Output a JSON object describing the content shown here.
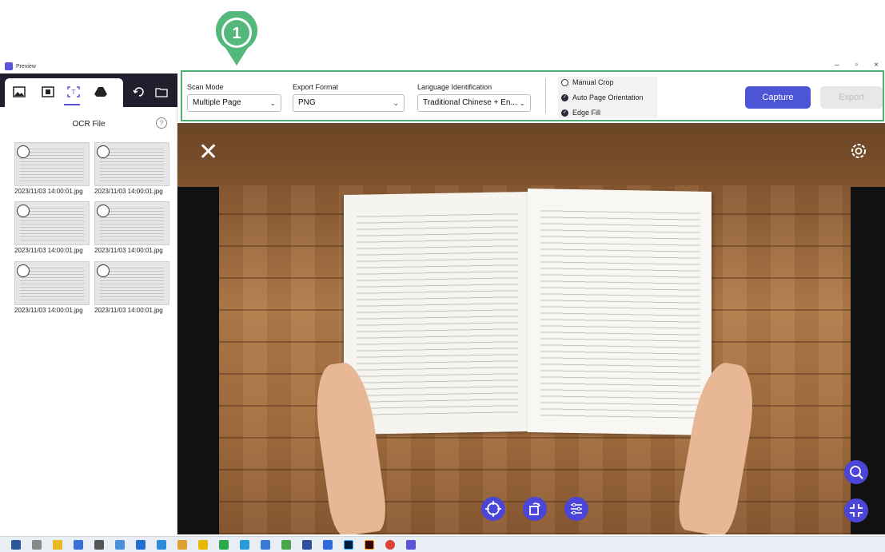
{
  "callout": {
    "number": "1"
  },
  "window": {
    "title": "Preview",
    "minimize": "–",
    "restore": "▫",
    "close": "×"
  },
  "sidebar": {
    "title": "OCR File",
    "help": "?",
    "files": [
      {
        "name": "2023/11/03 14:00:01.jpg"
      },
      {
        "name": "2023/11/03 14:00:01.jpg"
      },
      {
        "name": "2023/11/03 14:00:01.jpg"
      },
      {
        "name": "2023/11/03 14:00:01.jpg"
      },
      {
        "name": "2023/11/03 14:00:01.jpg"
      },
      {
        "name": "2023/11/03 14:00:01.jpg"
      }
    ],
    "collapse": "‹"
  },
  "toolbar": {
    "scan_mode": {
      "label": "Scan Mode",
      "value": "Multiple Page"
    },
    "export_format": {
      "label": "Export Format",
      "value": "PNG"
    },
    "language": {
      "label": "Language Identification",
      "value": "Traditional Chinese + En..."
    },
    "options": [
      {
        "label": "Manual Crop",
        "checked": false
      },
      {
        "label": "Auto Page Orientation",
        "checked": true
      },
      {
        "label": "Edge Fill",
        "checked": true
      }
    ],
    "capture_label": "Capture",
    "export_label": "Export"
  },
  "preview": {
    "close": "✕"
  },
  "colors": {
    "accent": "#4b55d6",
    "highlight_border": "#4caf73",
    "dark": "#1f1f2e"
  }
}
